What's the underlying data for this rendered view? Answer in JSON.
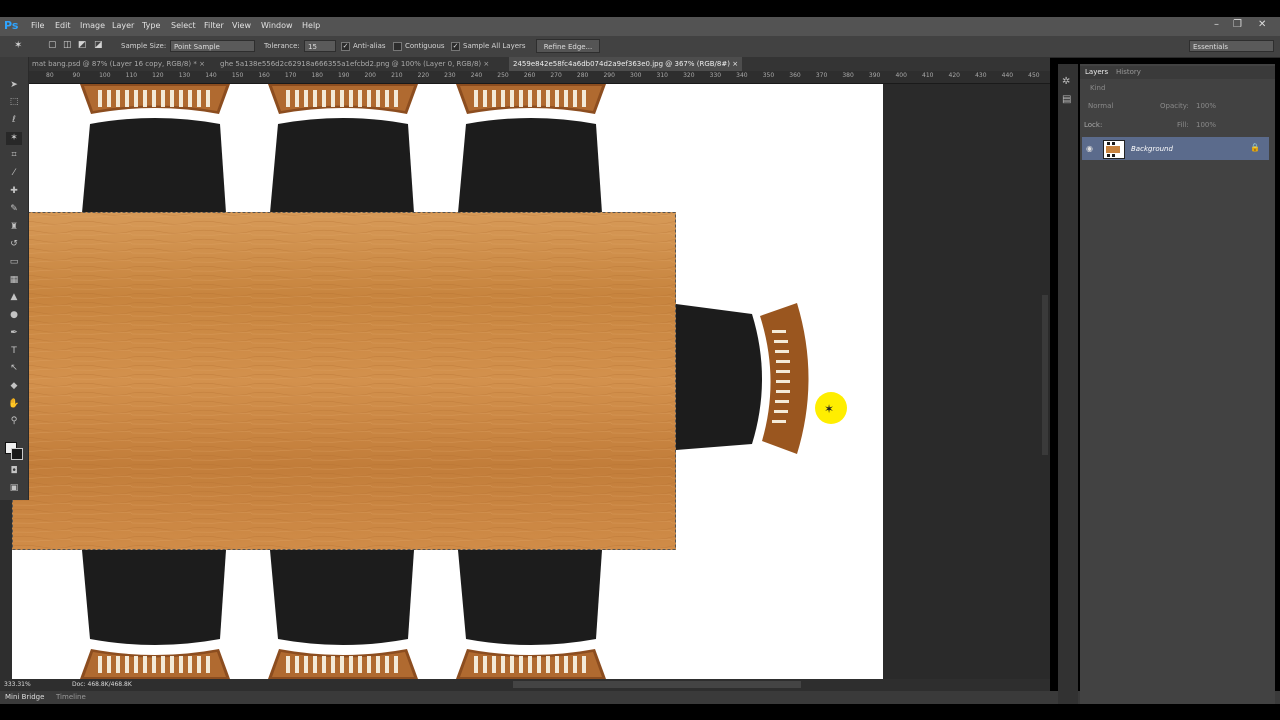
{
  "app": {
    "logo": "Ps"
  },
  "menu": [
    "File",
    "Edit",
    "Image",
    "Layer",
    "Type",
    "Select",
    "Filter",
    "View",
    "Window",
    "Help"
  ],
  "window_controls": [
    "–",
    "❐",
    "✕"
  ],
  "options": {
    "sample_size_label": "Sample Size:",
    "sample_size_value": "Point Sample",
    "tolerance_label": "Tolerance:",
    "tolerance_value": "15",
    "anti_alias": "Anti-alias",
    "contiguous": "Contiguous",
    "sample_all_layers": "Sample All Layers",
    "refine_edge": "Refine Edge...",
    "workspace": "Essentials",
    "check_mark": "✓"
  },
  "tabs": [
    {
      "label": "mat bang.psd @ 87% (Layer 16 copy, RGB/8) *",
      "close": "×"
    },
    {
      "label": "ghe 5a138e556d2c62918a666355a1efcbd2.png @ 100% (Layer 0, RGB/8)",
      "close": "×"
    },
    {
      "label": "2459e842e58fc4a6db074d2a9ef363e0.jpg @ 367% (RGB/8#)",
      "close": "×"
    }
  ],
  "ruler_labels": [
    "80",
    "90",
    "100",
    "110",
    "120",
    "130",
    "140",
    "150",
    "160",
    "170",
    "180",
    "190",
    "200",
    "210",
    "220",
    "230",
    "240",
    "250",
    "260",
    "270",
    "280",
    "290",
    "300",
    "310",
    "320",
    "330",
    "340",
    "350",
    "360",
    "370",
    "380",
    "390",
    "400",
    "410",
    "420",
    "430",
    "440",
    "450"
  ],
  "status": {
    "zoom": "333.31%",
    "doc": "Doc: 468.8K/468.8K"
  },
  "bottom": {
    "mini_bridge": "Mini Bridge",
    "timeline": "Timeline"
  },
  "layers_panel": {
    "tabs": [
      "Layers",
      "History"
    ],
    "kind": "Kind",
    "blend_mode": "Normal",
    "opacity_label": "Opacity:",
    "opacity_value": "100%",
    "lock_label": "Lock:",
    "fill_label": "Fill:",
    "fill_value": "100%",
    "layer_name": "Background"
  },
  "colors": {
    "accent": "#2fa4ff",
    "table_wood": "#c8833f",
    "chair_black": "#1c1c1c",
    "selection_layer": "#5b6b8c",
    "cursor_highlight": "#ffee00"
  }
}
